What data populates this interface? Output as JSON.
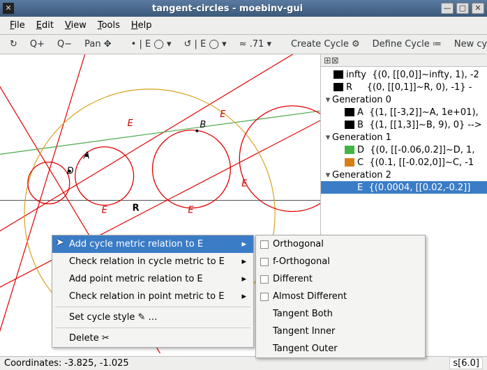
{
  "window": {
    "title": "tangent-circles - moebinv-gui",
    "icon_glyph": "✕"
  },
  "menubar": [
    {
      "label": "File",
      "accel": "F"
    },
    {
      "label": "Edit",
      "accel": "E"
    },
    {
      "label": "View",
      "accel": "V"
    },
    {
      "label": "Tools",
      "accel": "T"
    },
    {
      "label": "Help",
      "accel": "H"
    }
  ],
  "toolbar": {
    "refresh": "↻",
    "qplus": "Q+",
    "qminus": "Q−",
    "pan": "Pan ✥",
    "g1": "• | E ◯ ▾",
    "g2": "↺ | E ◯ ▾",
    "zoom": "≈ .71 ▾",
    "create": "Create Cycle ⚙",
    "define": "Define Cycle ≔",
    "newcycle": "New cycle ↻"
  },
  "tree": {
    "infty": {
      "label": "infty",
      "detail": "{(0, [[0,0]]~infty, 1), -2",
      "color": "#000000"
    },
    "R": {
      "label": "R",
      "detail": "{(0, [[0,1]]~R, 0), -1} -",
      "color": "#000000"
    },
    "gen0": {
      "label": "Generation 0"
    },
    "A": {
      "label": "A",
      "detail": "{(1, [[-3,2]]~A, 1e+01),",
      "color": "#000000"
    },
    "B": {
      "label": "B",
      "detail": "{(1, [[1,3]]~B, 9), 0} -->",
      "color": "#000000"
    },
    "gen1": {
      "label": "Generation 1"
    },
    "D": {
      "label": "D",
      "detail": "{(0, [[-0.06,0.2]]~D, 1,",
      "color": "#45b245"
    },
    "C": {
      "label": "C",
      "detail": "{(0.1, [[-0.02,0]]~C, -1",
      "color": "#d97f1a"
    },
    "gen2": {
      "label": "Generation 2"
    },
    "E": {
      "label": "E",
      "detail": "{(0.0004, [[0.02,-0.2]]",
      "color": "#3b7cc6"
    }
  },
  "canvas": {
    "labels": {
      "R": "R",
      "A": "A",
      "B": "B",
      "D": "D",
      "E": "E"
    }
  },
  "context_menu": {
    "items": [
      {
        "label": "Add cycle metric relation to E",
        "submenu": true,
        "hl": true
      },
      {
        "label": "Check relation in cycle metric to E",
        "submenu": true
      },
      {
        "label": "Add point metric relation to E",
        "submenu": true
      },
      {
        "label": "Check relation in point metric to E",
        "submenu": true
      }
    ],
    "style": "Set cycle style ✎ …",
    "delete": "Delete ✂"
  },
  "submenu": {
    "items": [
      {
        "label": "Orthogonal",
        "check": true
      },
      {
        "label": "f-Orthogonal",
        "check": true
      },
      {
        "label": "Different",
        "check": true
      },
      {
        "label": "Almost Different",
        "check": true
      },
      {
        "label": "Tangent Both"
      },
      {
        "label": "Tangent Inner"
      },
      {
        "label": "Tangent Outer"
      }
    ]
  },
  "status": {
    "left": "Coordinates: -3.825, -1.025",
    "right": "s[6.0]"
  }
}
